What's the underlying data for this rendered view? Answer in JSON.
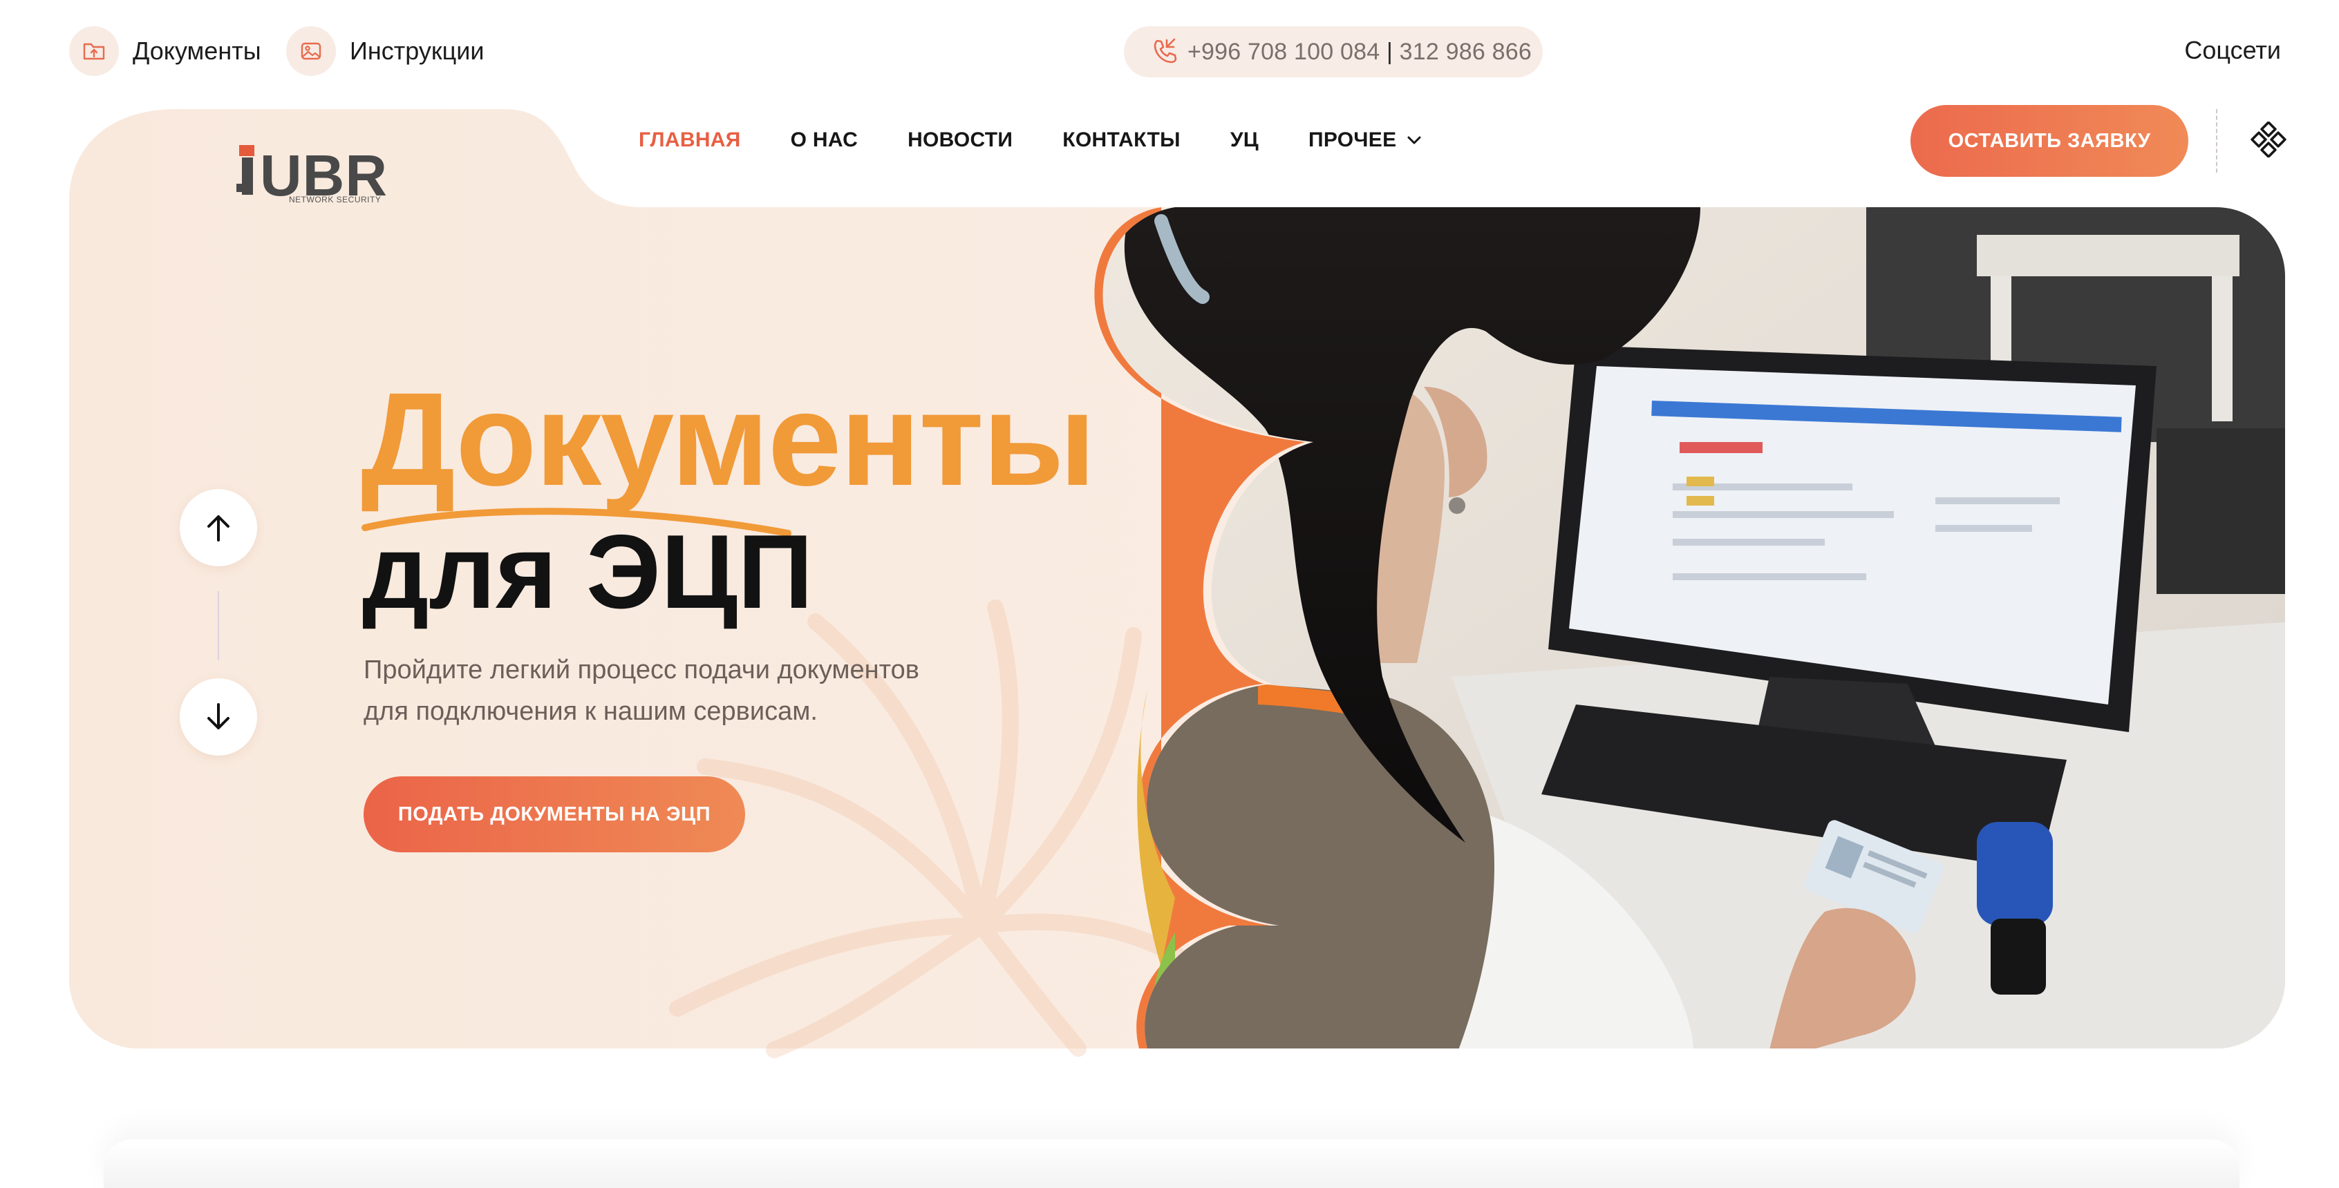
{
  "topbar": {
    "documents_label": "Документы",
    "instructions_label": "Инструкции",
    "phone_1": "+996 708 100 084",
    "phone_separator": "|",
    "phone_2": "312 986 866",
    "socials_label": "Соцсети"
  },
  "logo": {
    "name": "UBR",
    "subtitle": "NETWORK SECURITY"
  },
  "nav": {
    "items": [
      {
        "label": "ГЛАВНАЯ",
        "active": true
      },
      {
        "label": "О НАС",
        "active": false
      },
      {
        "label": "НОВОСТИ",
        "active": false
      },
      {
        "label": "КОНТАКТЫ",
        "active": false
      },
      {
        "label": "УЦ",
        "active": false
      },
      {
        "label": "ПРОЧЕЕ",
        "active": false,
        "has_dropdown": true
      }
    ],
    "cta_label": "ОСТАВИТЬ ЗАЯВКУ"
  },
  "hero": {
    "title_accent": "Документы",
    "title_main": "для ЭЦП",
    "subtitle_line_1": "Пройдите легкий процесс подачи документов",
    "subtitle_line_2": "для подключения к нашим сервисам.",
    "cta_label": "ПОДАТЬ ДОКУМЕНТЫ НА ЭЦП"
  },
  "icons": {
    "documents": "folder-upload-icon",
    "instructions": "image-icon",
    "phone": "phone-call-icon",
    "menu": "grid-diamond-icon",
    "slider_up": "arrow-up-icon",
    "slider_down": "arrow-down-icon"
  },
  "colors": {
    "accent": "#E85F43",
    "title_orange": "#F19A38",
    "hero_background": "#F9ECE3",
    "button_gradient_start": "#EB6448",
    "button_gradient_end": "#EF8A55"
  }
}
